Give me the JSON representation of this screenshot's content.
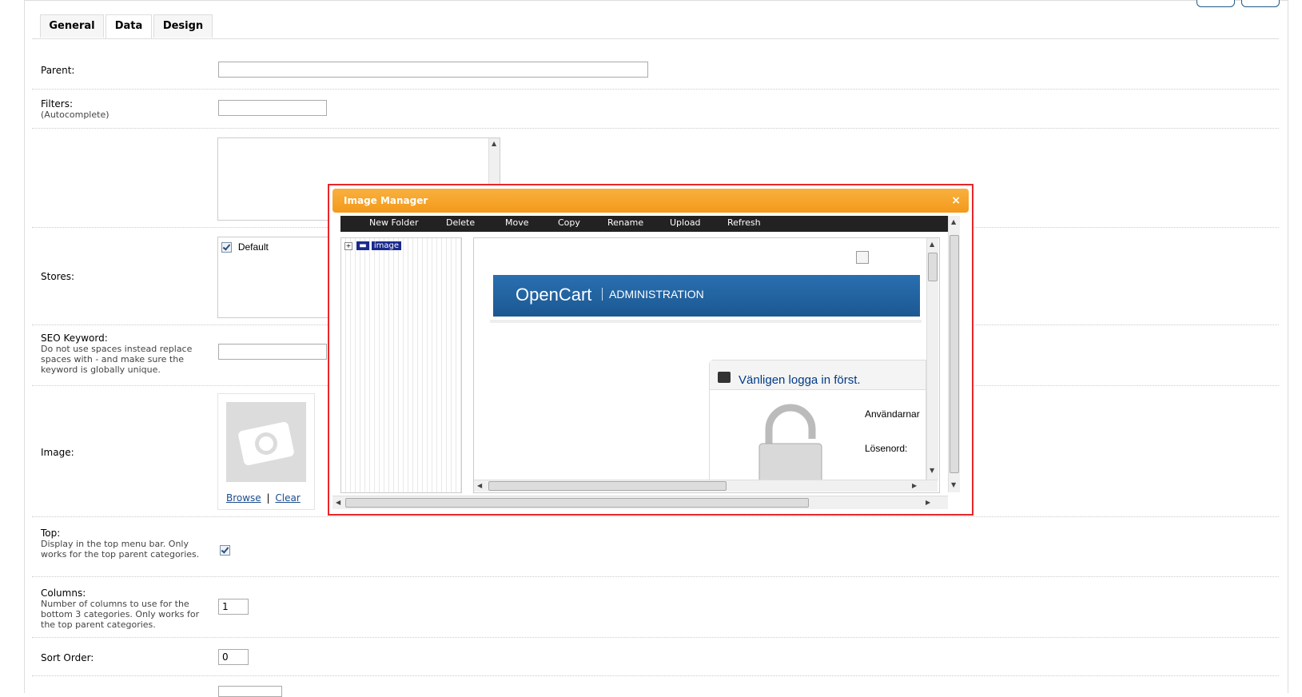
{
  "tabs": [
    {
      "label": "General"
    },
    {
      "label": "Data"
    },
    {
      "label": "Design"
    }
  ],
  "form": {
    "parent_label": "Parent:",
    "filters_label": "Filters:",
    "filters_help": "(Autocomplete)",
    "stores_label": "Stores:",
    "stores_default": "Default",
    "seo_label": "SEO Keyword:",
    "seo_help": "Do not use spaces instead replace spaces with - and make sure the keyword is globally unique.",
    "image_label": "Image:",
    "image_browse": "Browse",
    "image_sep": "|",
    "image_clear": "Clear",
    "top_label": "Top:",
    "top_help": "Display in the top menu bar. Only works for the top parent categories.",
    "columns_label": "Columns:",
    "columns_help": "Number of columns to use for the bottom 3 categories. Only works for the top parent categories.",
    "columns_value": "1",
    "sort_label": "Sort Order:",
    "sort_value": "0"
  },
  "modal": {
    "title": "Image Manager",
    "close": "×",
    "toolbar": [
      "New Folder",
      "Delete",
      "Move",
      "Copy",
      "Rename",
      "Upload",
      "Refresh"
    ],
    "tree_root": "image",
    "frame": {
      "brand": "OpenCart",
      "brand_sub": "ADMINISTRATION",
      "login_title": "Vänligen logga in först.",
      "username_label": "Användarnar",
      "password_label": "Lösenord:"
    }
  }
}
